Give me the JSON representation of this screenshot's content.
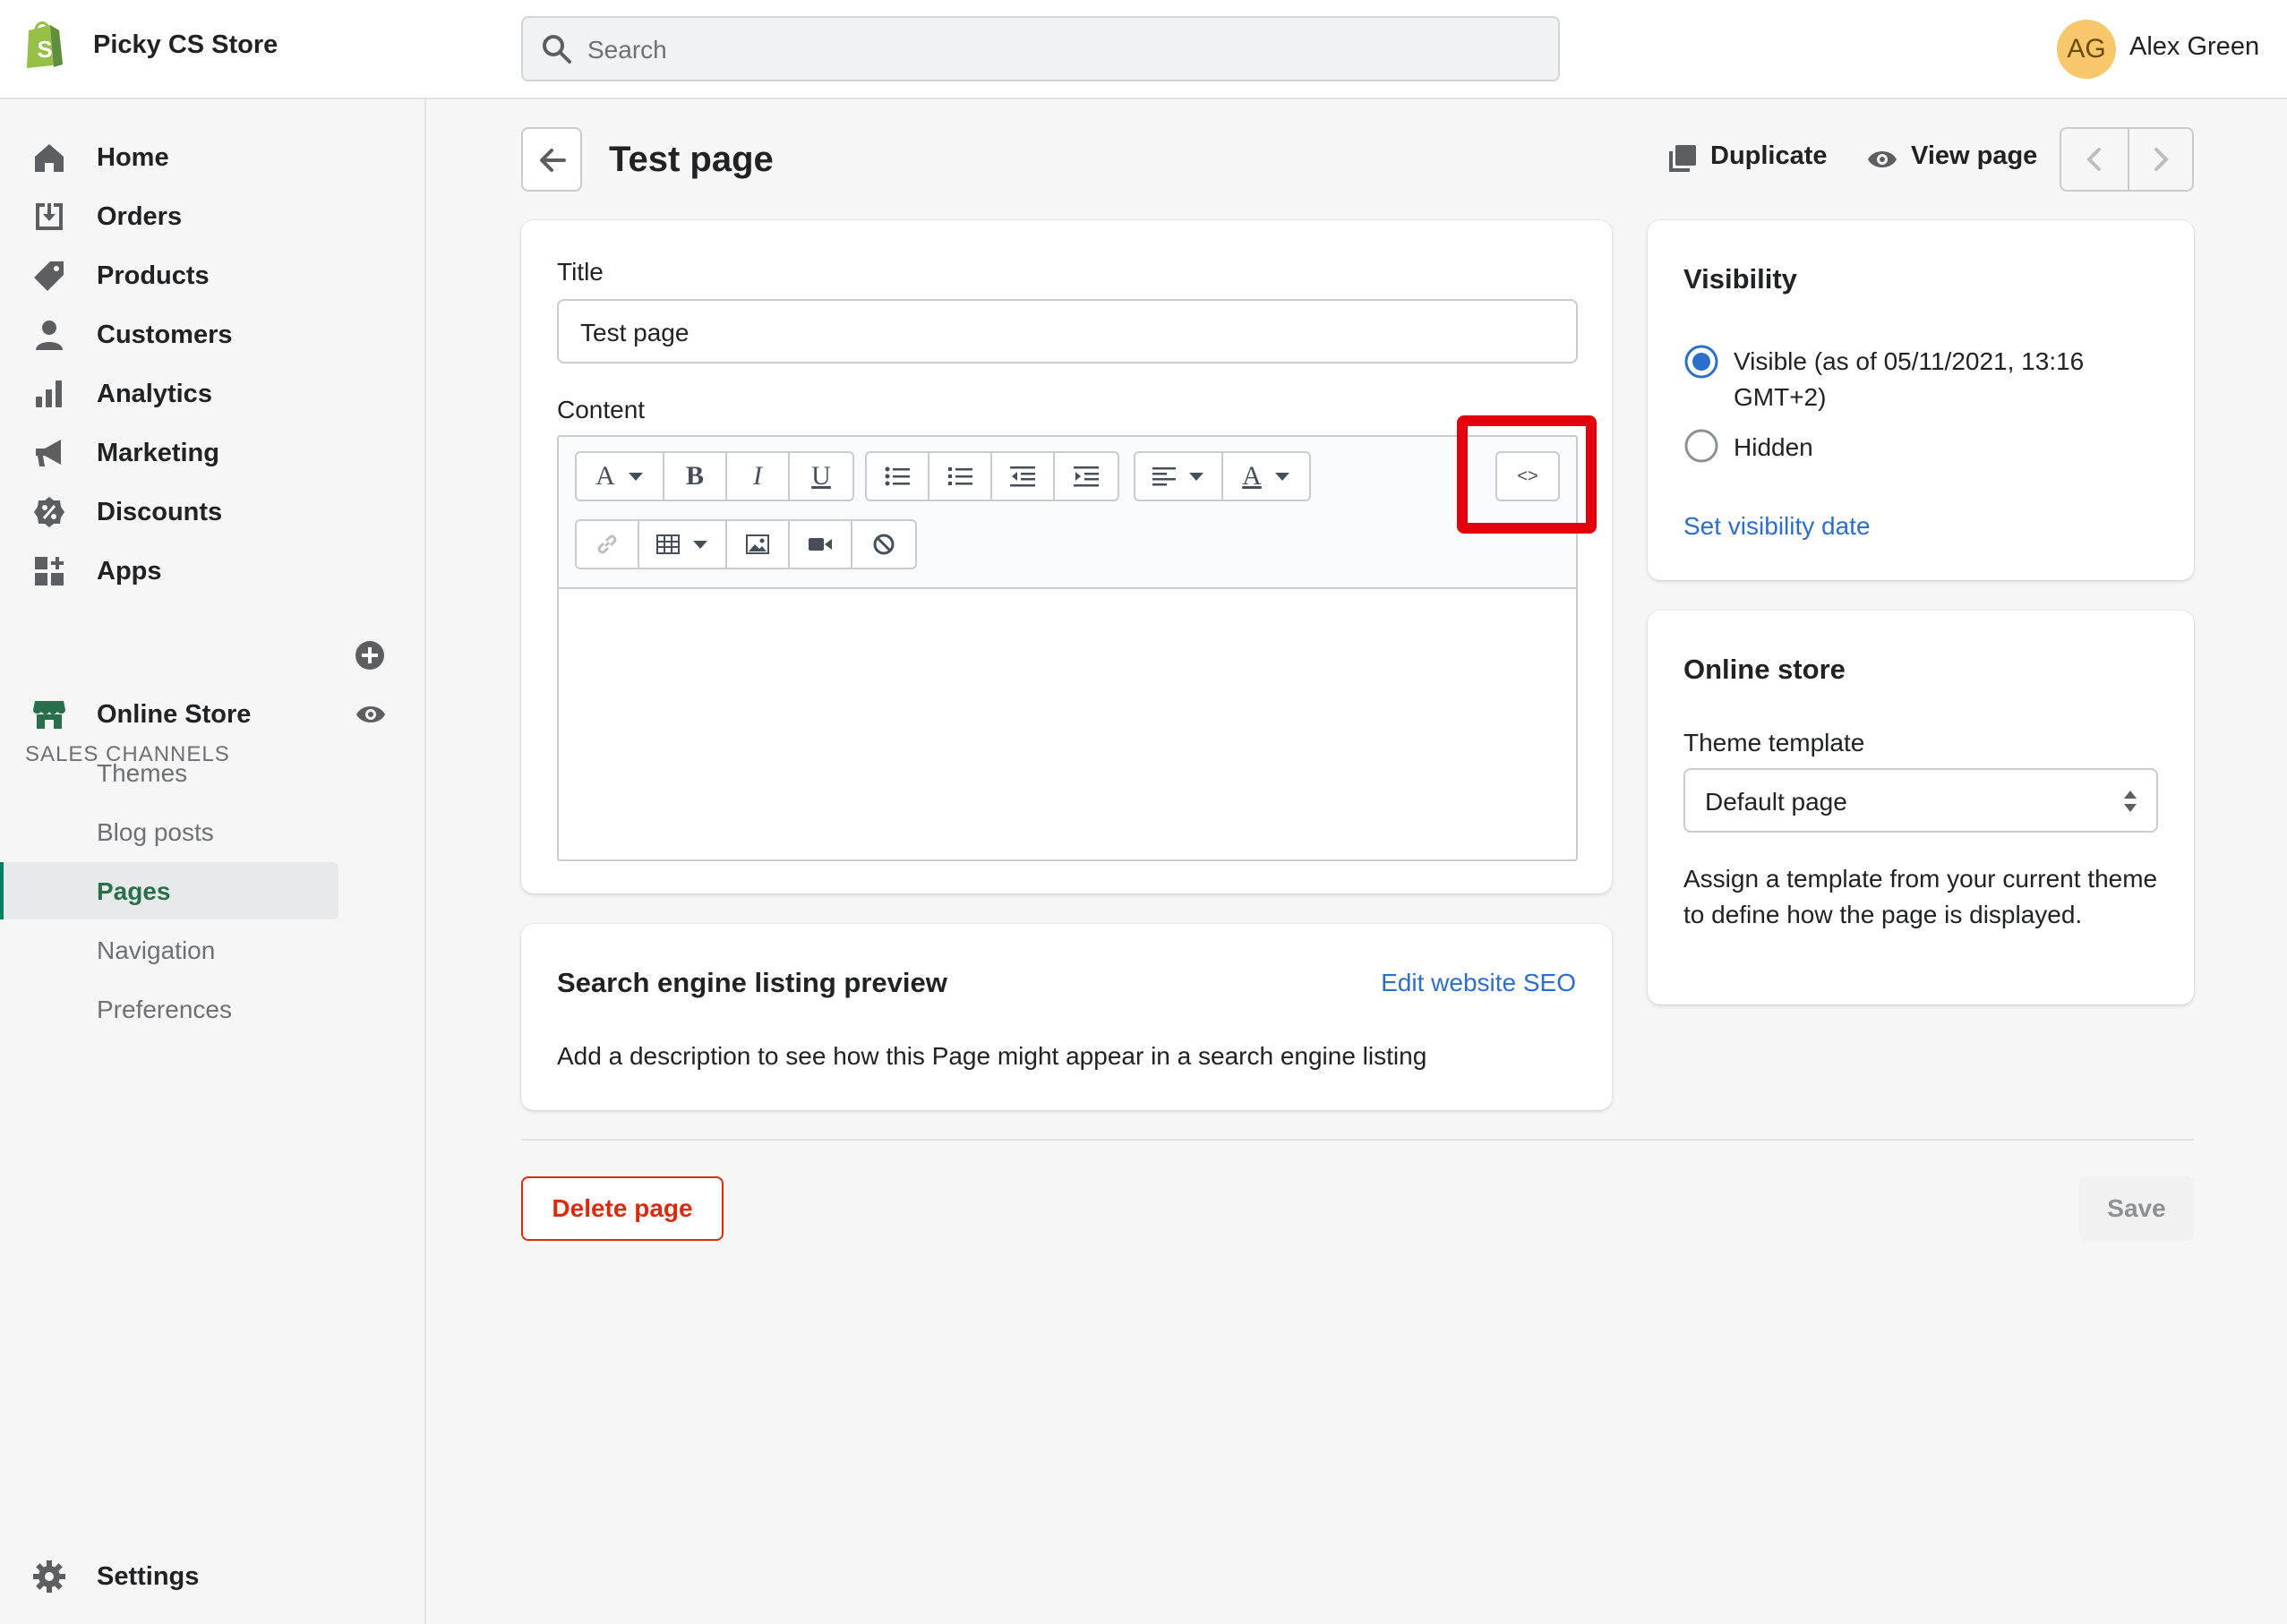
{
  "app": {
    "store_name": "Picky CS Store",
    "search_placeholder": "Search",
    "user_initials": "AG",
    "user_name": "Alex Green"
  },
  "sidebar": {
    "items": [
      {
        "label": "Home",
        "icon": "home-icon"
      },
      {
        "label": "Orders",
        "icon": "orders-icon"
      },
      {
        "label": "Products",
        "icon": "tag-icon"
      },
      {
        "label": "Customers",
        "icon": "person-icon"
      },
      {
        "label": "Analytics",
        "icon": "bar-chart-icon"
      },
      {
        "label": "Marketing",
        "icon": "megaphone-icon"
      },
      {
        "label": "Discounts",
        "icon": "discount-icon"
      },
      {
        "label": "Apps",
        "icon": "apps-icon"
      }
    ],
    "sales_channels_label": "SALES CHANNELS",
    "online_store_label": "Online Store",
    "sub_items": [
      {
        "label": "Themes",
        "active": false
      },
      {
        "label": "Blog posts",
        "active": false
      },
      {
        "label": "Pages",
        "active": true
      },
      {
        "label": "Navigation",
        "active": false
      },
      {
        "label": "Preferences",
        "active": false
      }
    ],
    "settings_label": "Settings"
  },
  "header": {
    "title": "Test page",
    "duplicate_label": "Duplicate",
    "view_page_label": "View page"
  },
  "main_card": {
    "title_label": "Title",
    "title_value": "Test page",
    "content_label": "Content",
    "toolbar_row1": [
      "font",
      "bold",
      "italic",
      "underline",
      "bullet-list",
      "numbered-list",
      "outdent",
      "indent",
      "align",
      "text-color"
    ],
    "toolbar_row2": [
      "link",
      "table",
      "image",
      "video",
      "clear-formatting"
    ],
    "html_toggle_label": "<>"
  },
  "seo_card": {
    "title": "Search engine listing preview",
    "edit_link": "Edit website SEO",
    "description": "Add a description to see how this Page might appear in a search engine listing"
  },
  "visibility_card": {
    "title": "Visibility",
    "visible_label": "Visible (as of 05/11/2021, 13:16 GMT+2)",
    "hidden_label": "Hidden",
    "selected": "visible",
    "set_date_link": "Set visibility date"
  },
  "online_store_card": {
    "title": "Online store",
    "template_label": "Theme template",
    "template_value": "Default page",
    "help_text": "Assign a template from your current theme to define how the page is displayed."
  },
  "footer": {
    "delete_label": "Delete page",
    "save_label": "Save"
  },
  "colors": {
    "accent_green": "#008060",
    "link_blue": "#2c6ecb",
    "danger_red": "#d82c0d",
    "highlight_red": "#e3000f"
  }
}
